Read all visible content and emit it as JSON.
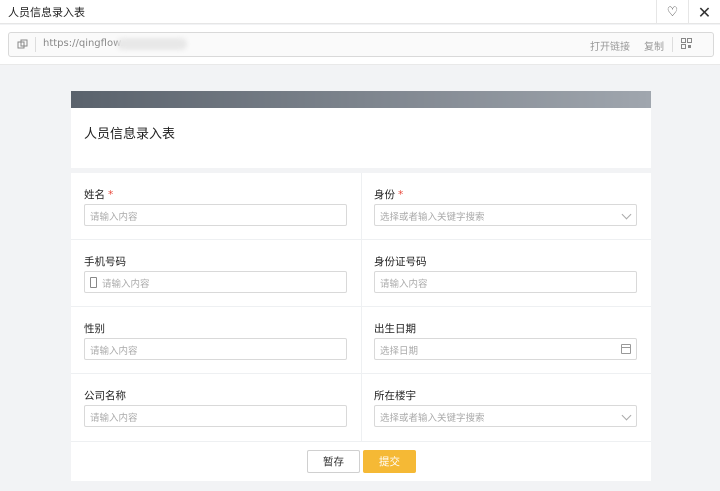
{
  "window": {
    "title": "人员信息录入表"
  },
  "urlbar": {
    "url": "https://qingflow.",
    "open_link": "打开链接",
    "copy": "复制"
  },
  "form": {
    "title": "人员信息录入表",
    "fields": {
      "name": {
        "label": "姓名",
        "required": "*",
        "placeholder": "请输入内容"
      },
      "identity": {
        "label": "身份",
        "required": "*",
        "placeholder": "选择或者输入关键字搜索"
      },
      "phone": {
        "label": "手机号码",
        "placeholder": "请输入内容"
      },
      "id_number": {
        "label": "身份证号码",
        "placeholder": "请输入内容"
      },
      "gender": {
        "label": "性别",
        "placeholder": "请输入内容"
      },
      "birth_date": {
        "label": "出生日期",
        "placeholder": "选择日期"
      },
      "company": {
        "label": "公司名称",
        "placeholder": "请输入内容"
      },
      "building": {
        "label": "所在楼宇",
        "placeholder": "选择或者输入关键字搜索"
      }
    },
    "buttons": {
      "save": "暂存",
      "submit": "提交"
    }
  },
  "colors": {
    "accent": "#f5b935",
    "required": "#e8483a",
    "banner_start": "#5a626c",
    "banner_end": "#a0a6ae"
  }
}
